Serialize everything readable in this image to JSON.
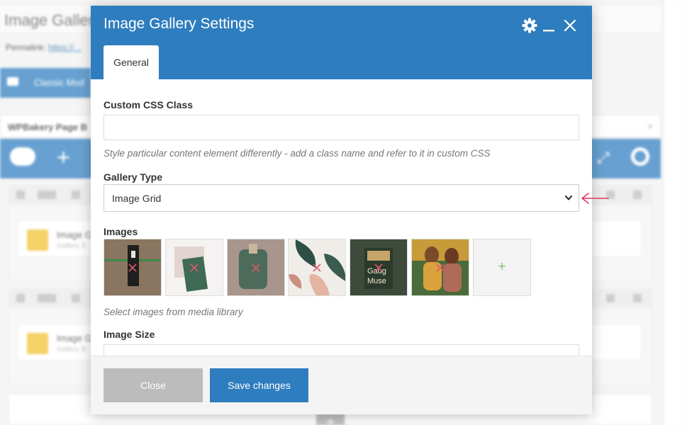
{
  "background": {
    "page_title": "Image Galler",
    "permalink_label": "Permalink:",
    "permalink_link": "https://...",
    "classic_mode": "Classic Mod",
    "wpbakery_header": "WPBakery Page B",
    "element_title": "Image G",
    "element_sub": "Gallery S"
  },
  "modal": {
    "title": "Image Gallery Settings",
    "header_icons": [
      "gear-icon",
      "minimize-icon",
      "close-icon"
    ],
    "tabs": [
      {
        "label": "General",
        "active": true
      }
    ],
    "fields": {
      "css_class": {
        "label": "Custom CSS Class",
        "value": "",
        "help": "Style particular content element differently - add a class name and refer to it in custom CSS"
      },
      "gallery_type": {
        "label": "Gallery Type",
        "selected": "Image Grid"
      },
      "images": {
        "label": "Images",
        "help": "Select images from media library",
        "thumbnails": [
          {
            "name": "thumb-1",
            "colors": [
              "#8a7560",
              "#1f1f1f"
            ]
          },
          {
            "name": "thumb-2",
            "colors": [
              "#e2d4d0",
              "#3f6a55"
            ]
          },
          {
            "name": "thumb-3",
            "colors": [
              "#a8958c",
              "#4d6b5a"
            ]
          },
          {
            "name": "thumb-4",
            "colors": [
              "#f0ede8",
              "#2e4e46"
            ]
          },
          {
            "name": "thumb-5",
            "colors": [
              "#3e4a3b",
              "#c7a467"
            ],
            "text": [
              "Gaug",
              "Muse"
            ]
          },
          {
            "name": "thumb-6",
            "colors": [
              "#4a6b3a",
              "#d9a23c"
            ]
          }
        ],
        "add_label": "+"
      },
      "image_size": {
        "label": "Image Size",
        "value": ""
      }
    },
    "footer": {
      "close_label": "Close",
      "save_label": "Save changes"
    }
  },
  "colors": {
    "primary": "#2e7dbf",
    "close_button": "#bcbcbc",
    "remove_x": "#e05a6a",
    "add_plus": "#7ac36a",
    "annotation_arrow": "#e63462"
  }
}
